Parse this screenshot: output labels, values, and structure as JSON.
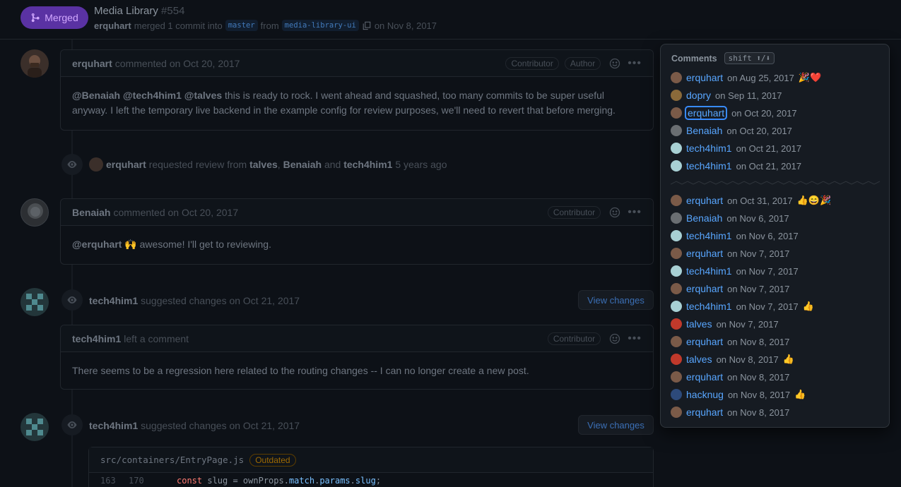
{
  "header": {
    "status": "Merged",
    "title": "Media Library",
    "number": "#554",
    "author": "erquhart",
    "merged_text": "merged 1 commit into",
    "base_branch": "master",
    "from_text": "from",
    "head_branch": "media-library-ui",
    "date_text": "on Nov 8, 2017"
  },
  "timeline": {
    "c1": {
      "author": "erquhart",
      "action": "commented on Oct 20, 2017",
      "label1": "Contributor",
      "label2": "Author",
      "body_mentions": "@Benaiah @tech4him1 @talves",
      "body_text": " this is ready to rock. I went ahead and squashed, too many commits to be super useful anyway. I left the temporary live backend in the example config for review purposes, we'll need to revert that before merging."
    },
    "e1": {
      "actor": "erquhart",
      "text1": "requested review from",
      "r1": "talves",
      "sep": ",",
      "r2": "Benaiah",
      "and": "and",
      "r3": "tech4him1",
      "time": "5 years ago"
    },
    "c2": {
      "author": "Benaiah",
      "action": "commented on Oct 20, 2017",
      "label1": "Contributor",
      "mention": "@erquhart",
      "body_text": " 🙌 awesome! I'll get to reviewing."
    },
    "e2": {
      "actor": "tech4him1",
      "text": "suggested changes on Oct 21, 2017",
      "button": "View changes"
    },
    "c3": {
      "author": "tech4him1",
      "action": "left a comment",
      "label1": "Contributor",
      "body_text": "There seems to be a regression here related to the routing changes -- I can no longer create a new post."
    },
    "e3": {
      "actor": "tech4him1",
      "text": "suggested changes on Oct 21, 2017",
      "button": "View changes"
    },
    "code": {
      "file": "src/containers/EntryPage.js",
      "badge": "Outdated",
      "ln_old": "163",
      "ln_new": "170",
      "kw": "const",
      "t1": " slug = ownProps.",
      "p1": "match",
      "t2": ".",
      "p2": "params",
      "t3": ".",
      "p3": "slug",
      "t4": ";"
    }
  },
  "panel": {
    "title": "Comments",
    "shortcut": "shift ⬆/⬇",
    "rows": [
      {
        "user": "erquhart",
        "date": "on Aug 25, 2017",
        "emoji": "🎉❤️"
      },
      {
        "user": "dopry",
        "date": "on Sep 11, 2017",
        "emoji": ""
      },
      {
        "user": "erquhart",
        "date": "on Oct 20, 2017",
        "emoji": ""
      },
      {
        "user": "Benaiah",
        "date": "on Oct 20, 2017",
        "emoji": ""
      },
      {
        "user": "tech4him1",
        "date": "on Oct 21, 2017",
        "emoji": ""
      },
      {
        "user": "tech4him1",
        "date": "on Oct 21, 2017",
        "emoji": ""
      },
      {
        "user": "erquhart",
        "date": "on Oct 31, 2017",
        "emoji": "👍😄🎉"
      },
      {
        "user": "Benaiah",
        "date": "on Nov 6, 2017",
        "emoji": ""
      },
      {
        "user": "tech4him1",
        "date": "on Nov 6, 2017",
        "emoji": ""
      },
      {
        "user": "erquhart",
        "date": "on Nov 7, 2017",
        "emoji": ""
      },
      {
        "user": "tech4him1",
        "date": "on Nov 7, 2017",
        "emoji": ""
      },
      {
        "user": "erquhart",
        "date": "on Nov 7, 2017",
        "emoji": ""
      },
      {
        "user": "tech4him1",
        "date": "on Nov 7, 2017",
        "emoji": "👍"
      },
      {
        "user": "talves",
        "date": "on Nov 7, 2017",
        "emoji": ""
      },
      {
        "user": "erquhart",
        "date": "on Nov 8, 2017",
        "emoji": ""
      },
      {
        "user": "talves",
        "date": "on Nov 8, 2017",
        "emoji": "👍"
      },
      {
        "user": "erquhart",
        "date": "on Nov 8, 2017",
        "emoji": ""
      },
      {
        "user": "hacknug",
        "date": "on Nov 8, 2017",
        "emoji": "👍"
      },
      {
        "user": "erquhart",
        "date": "on Nov 8, 2017",
        "emoji": ""
      }
    ]
  },
  "colors": {
    "accent": "#58a6ff",
    "merged": "#5a32a3",
    "background": "#0d1117"
  }
}
